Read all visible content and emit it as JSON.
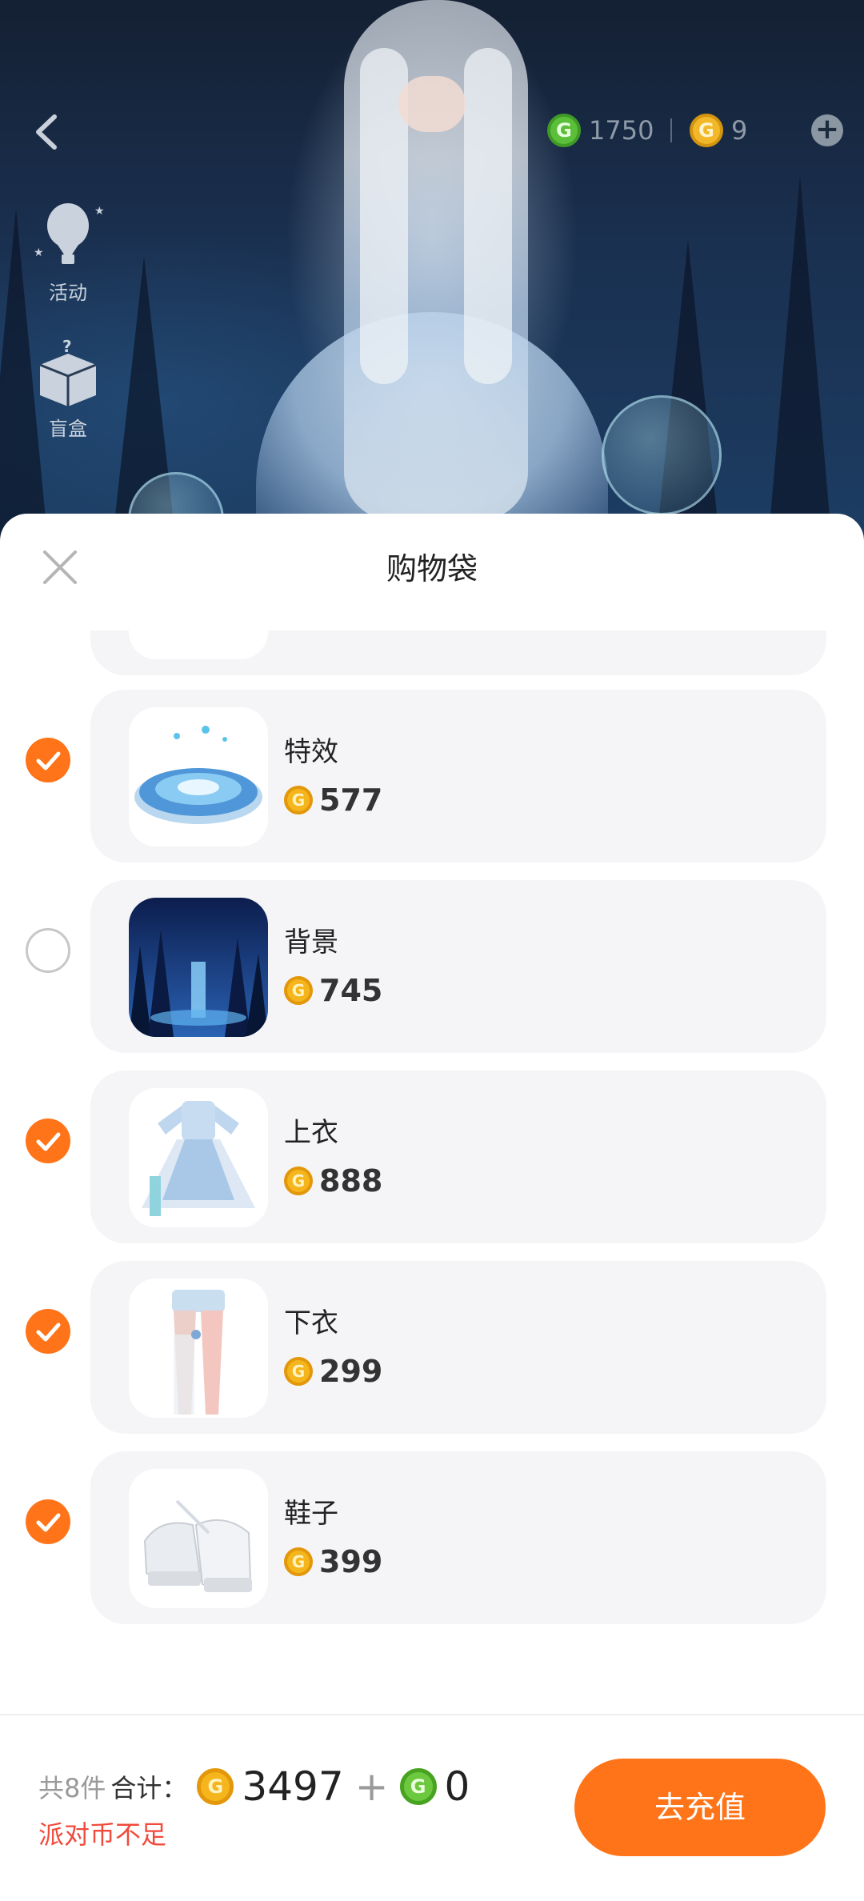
{
  "top": {
    "currency_green": "1750",
    "currency_gold": "9",
    "side_items": [
      {
        "label": "活动",
        "icon": "hot-air-balloon-icon"
      },
      {
        "label": "盲盒",
        "icon": "mystery-box-icon"
      }
    ]
  },
  "sheet": {
    "title": "购物袋",
    "items": [
      {
        "name": "特效",
        "price": "577",
        "checked": true
      },
      {
        "name": "背景",
        "price": "745",
        "checked": false
      },
      {
        "name": "上衣",
        "price": "888",
        "checked": true
      },
      {
        "name": "下衣",
        "price": "299",
        "checked": true
      },
      {
        "name": "鞋子",
        "price": "399",
        "checked": true
      }
    ]
  },
  "footer": {
    "count_text": "共8件",
    "total_label": "合计：",
    "gold_total": "3497",
    "plus": "+",
    "green_total": "0",
    "warning": "派对币不足",
    "recharge_label": "去充值"
  },
  "colors": {
    "accent": "#ff7418",
    "warning": "#f04a3c",
    "gold_coin": "#f5b51c",
    "green_coin": "#6cc83e"
  }
}
